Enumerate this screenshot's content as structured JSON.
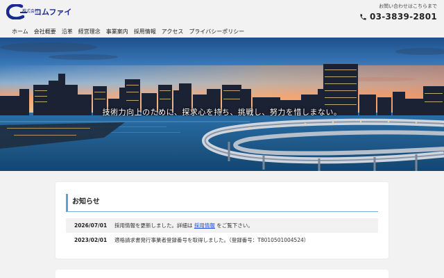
{
  "header": {
    "logo": {
      "small_text": "株式会社",
      "name": "コムファイ"
    },
    "contact": {
      "label": "お問い合わせはこちらまで",
      "phone": "03-3839-2801",
      "icon": "phone-icon"
    }
  },
  "nav": {
    "items": [
      {
        "label": "ホーム"
      },
      {
        "label": "会社概要"
      },
      {
        "label": "沿革"
      },
      {
        "label": "経営理念"
      },
      {
        "label": "事業案内"
      },
      {
        "label": "採用情報"
      },
      {
        "label": "アクセス"
      },
      {
        "label": "プライバシーポリシー"
      }
    ]
  },
  "hero": {
    "caption": "技術力向上のために、探求心を持ち、挑戦し、努力を惜しまない。"
  },
  "news": {
    "title": "お知らせ",
    "items": [
      {
        "date": "2026/07/01",
        "text_before": "採用情報を更新しました。詳細は",
        "link": "採用情報",
        "text_after": "をご覧下さい。"
      },
      {
        "date": "2023/02/01",
        "text": "適格請求書発行事業者登録番号を取得しました。（登録番号：T8010501004524）"
      }
    ]
  },
  "colors": {
    "brand": "#1a2a8c",
    "accent": "#5aa3d8",
    "link": "#1d4fd8"
  }
}
